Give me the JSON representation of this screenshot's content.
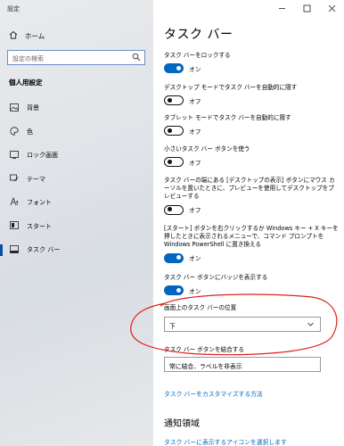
{
  "window": {
    "title": "設定",
    "minimize_icon": "minimize-icon",
    "maximize_icon": "maximize-icon",
    "close_icon": "close-icon"
  },
  "sidebar": {
    "home_label": "ホーム",
    "search_placeholder": "設定の検索",
    "section_title": "個人用設定",
    "items": [
      {
        "label": "背景",
        "icon": "image-icon"
      },
      {
        "label": "色",
        "icon": "palette-icon"
      },
      {
        "label": "ロック画面",
        "icon": "lock-screen-icon"
      },
      {
        "label": "テーマ",
        "icon": "theme-brush-icon"
      },
      {
        "label": "フォント",
        "icon": "font-icon"
      },
      {
        "label": "スタート",
        "icon": "start-icon"
      },
      {
        "label": "タスク バー",
        "icon": "taskbar-icon",
        "active": true
      }
    ]
  },
  "main": {
    "title": "タスク バー",
    "settings": [
      {
        "label": "タスク バーをロックする",
        "state": "オン",
        "on": true
      },
      {
        "label": "デスクトップ モードでタスク バーを自動的に隠す",
        "state": "オフ",
        "on": false
      },
      {
        "label": "タブレット モードでタスク バーを自動的に隠す",
        "state": "オフ",
        "on": false
      },
      {
        "label": "小さいタスク バー ボタンを使う",
        "state": "オフ",
        "on": false
      },
      {
        "label": "タスク バーの端にある [デスクトップの表示] ボタンにマウス カーソルを置いたときに、プレビューを使用してデスクトップをプレビューする",
        "state": "オフ",
        "on": false
      },
      {
        "label": "[スタート] ボタンを右クリックするか Windows キー + X キーを押したときに表示されるメニューで、コマンド プロンプトを Windows PowerShell に置き換える",
        "state": "オン",
        "on": true
      },
      {
        "label": "タスク バー ボタンにバッジを表示する",
        "state": "オン",
        "on": true
      }
    ],
    "position": {
      "label": "画面上のタスク バーの位置",
      "value": "下"
    },
    "combine": {
      "label": "タスク バー ボタンを結合する",
      "value": "常に結合、ラベルを非表示"
    },
    "customize_link": "タスク バーをカスタマイズする方法",
    "notification_heading": "通知領域",
    "notification_link": "タスク バーに表示するアイコンを選択します"
  },
  "annotation": {
    "color": "#e0201b"
  }
}
